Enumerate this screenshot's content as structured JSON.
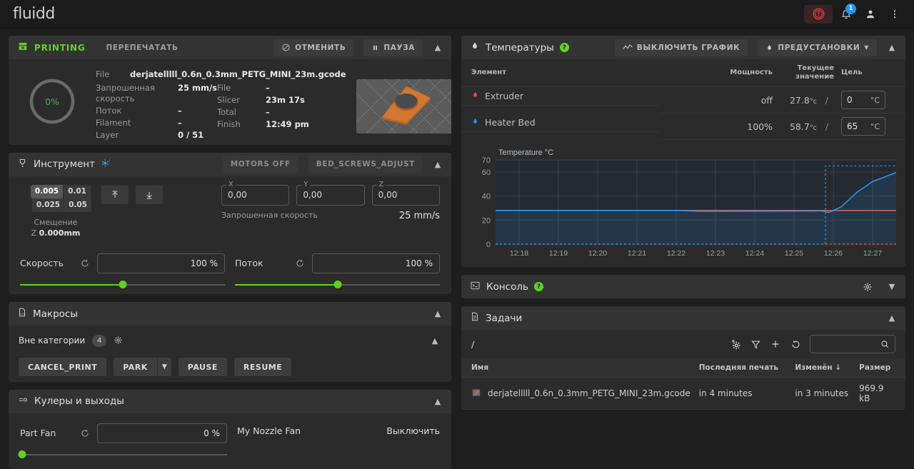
{
  "app": {
    "brand": "fluidd"
  },
  "topbar": {
    "estop_title": "Emergency Stop",
    "notification_count": "1"
  },
  "status": {
    "state_label": "PRINTING",
    "reprint_label": "ПЕРЕПЕЧАТАТЬ",
    "cancel_label": "ОТМЕНИТЬ",
    "pause_label": "ПАУЗА",
    "progress": "0%",
    "file_key": "File",
    "file_value": "derjatelllll_0.6n_0.3mm_PETG_MINI_23m.gcode",
    "left": [
      {
        "k": "Запрошенная скорость",
        "v": "25 mm/s"
      },
      {
        "k": "Поток",
        "v": "–"
      },
      {
        "k": "Filament",
        "v": "–"
      },
      {
        "k": "Layer",
        "v": "0 / 51"
      }
    ],
    "right": [
      {
        "k": "File",
        "v": "–"
      },
      {
        "k": "Slicer",
        "v": "23m 17s"
      },
      {
        "k": "Total",
        "v": "–"
      },
      {
        "k": "Finish",
        "v": "12:49 pm"
      }
    ]
  },
  "tool": {
    "title": "Инструмент",
    "motors_off_label": "MOTORS OFF",
    "bed_screws_label": "BED_SCREWS_ADJUST",
    "steps": [
      "0.005",
      "0.01",
      "0.025",
      "0.05"
    ],
    "selected_step": "0.005",
    "offset_label": "Смещение",
    "offset_axis": "Z",
    "offset_value": "0.000mm",
    "axes": [
      {
        "label": "X",
        "value": "0,00"
      },
      {
        "label": "Y",
        "value": "0,00"
      },
      {
        "label": "Z",
        "value": "0,00"
      }
    ],
    "requested_speed_label": "Запрошенная скорость",
    "requested_speed_value": "25 mm/s",
    "sliders": [
      {
        "name": "Скорость",
        "value": "100 %",
        "percent": 50
      },
      {
        "name": "Поток",
        "value": "100 %",
        "percent": 50
      }
    ]
  },
  "macros": {
    "title": "Макросы",
    "category": "Вне категории",
    "count": "4",
    "buttons": [
      "CANCEL_PRINT",
      "PARK",
      "PAUSE",
      "RESUME"
    ],
    "split_button": "PARK"
  },
  "fans": {
    "title": "Кулеры и выходы",
    "part_fan_name": "Part Fan",
    "part_fan_value": "0 %",
    "part_fan_percent": 0,
    "nozzle_fan_name": "My Nozzle Fan",
    "nozzle_fan_action": "Выключить"
  },
  "temperature": {
    "title": "Температуры",
    "help": "?",
    "chart_toggle_label": "ВЫКЛЮЧИТЬ ГРАФИК",
    "presets_label": "ПРЕДУСТАНОВКИ",
    "columns": {
      "item": "Элемент",
      "power": "Мощность",
      "current": "Текущее значение",
      "target": "Цель"
    },
    "rows": [
      {
        "name": "Extruder",
        "power": "off",
        "current": "27.8",
        "unit": "°c",
        "target": "0",
        "target_unit": "°C",
        "color": "#e2574c"
      },
      {
        "name": "Heater Bed",
        "power": "100%",
        "current": "58.7",
        "unit": "°c",
        "target": "65",
        "target_unit": "°C",
        "color": "#2196f3"
      }
    ]
  },
  "chart_data": {
    "type": "line",
    "title": "Temperature °C",
    "xlabel": "",
    "ylabel": "Temperature °C",
    "ylim": [
      0,
      70
    ],
    "yticks": [
      0,
      20,
      40,
      60,
      70
    ],
    "xticks": [
      "12:18",
      "12:19",
      "12:20",
      "12:21",
      "12:22",
      "12:23",
      "12:24",
      "12:25",
      "12:26",
      "12:27"
    ],
    "grid": true,
    "legend": "none",
    "series": [
      {
        "name": "Extruder",
        "color": "#e2574c",
        "x": [
          "12:17.4",
          "12:18",
          "12:19",
          "12:20",
          "12:21",
          "12:22",
          "12:22.6",
          "12:23",
          "12:24",
          "12:25",
          "12:25.8",
          "12:26",
          "12:27",
          "12:27.6"
        ],
        "values": [
          28,
          28,
          28,
          28,
          28,
          28,
          28,
          28,
          28,
          28,
          28,
          28,
          28,
          28
        ]
      },
      {
        "name": "Extruder Target",
        "color": "#e2574c",
        "style": "dashed",
        "x": [
          "12:17.4",
          "12:27.6"
        ],
        "values": [
          0,
          0
        ]
      },
      {
        "name": "Heater Bed",
        "color": "#2196f3",
        "x": [
          "12:17.4",
          "12:18",
          "12:19",
          "12:20",
          "12:21",
          "12:22",
          "12:22.6",
          "12:23",
          "12:24",
          "12:25",
          "12:25.7",
          "12:25.9",
          "12:26.2",
          "12:26.6",
          "12:27",
          "12:27.6"
        ],
        "values": [
          28,
          28,
          28,
          28,
          28,
          28,
          27.3,
          27.3,
          27.4,
          27.5,
          27.6,
          26.5,
          31,
          43,
          52,
          59.5
        ]
      },
      {
        "name": "Heater Bed Target",
        "color": "#2196f3",
        "style": "dashed",
        "x": [
          "12:17.4",
          "12:25.8",
          "12:25.8",
          "12:27.6"
        ],
        "values": [
          0,
          0,
          65,
          65
        ]
      }
    ]
  },
  "console": {
    "title": "Консоль",
    "help": "?"
  },
  "jobs": {
    "title": "Задачи",
    "path": "/",
    "search_placeholder": "",
    "columns": [
      "Имя",
      "Последняя печать",
      "Изменён",
      "Размер"
    ],
    "sorted_column": "Изменён",
    "rows": [
      {
        "name": "derjatelllll_0.6n_0.3mm_PETG_MINI_23m.gcode",
        "last_print": "in 4 minutes",
        "modified": "in 3 minutes",
        "size": "969.9 kB"
      }
    ]
  }
}
